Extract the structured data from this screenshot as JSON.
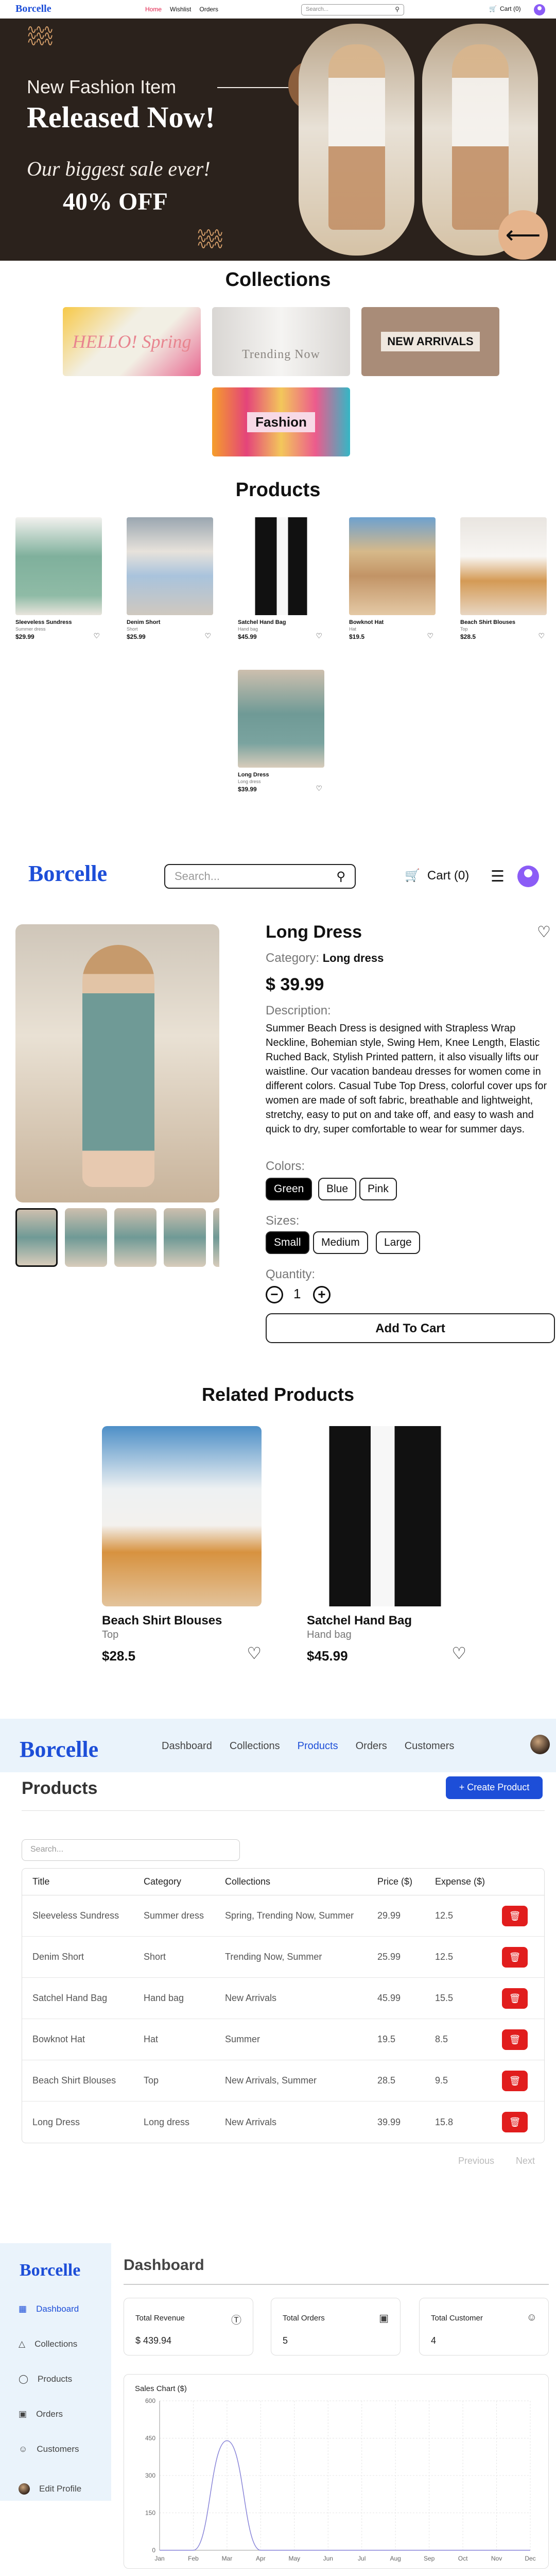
{
  "store_nav": {
    "logo": "Borcelle",
    "links": [
      {
        "label": "Home",
        "active": true
      },
      {
        "label": "Wishlist",
        "active": false
      },
      {
        "label": "Orders",
        "active": false
      }
    ],
    "search_placeholder": "Search...",
    "cart_label": "Cart (0)"
  },
  "hero": {
    "line1": "New Fashion Item",
    "line2": "Released Now!",
    "line3": "Our biggest sale ever!",
    "line4": "40% OFF"
  },
  "collections": {
    "title": "Collections",
    "cards": [
      {
        "label": "HELLO! Spring"
      },
      {
        "label": "Trending Now"
      },
      {
        "label": "NEW ARRIVALS"
      },
      {
        "label": "Fashion"
      }
    ]
  },
  "products": {
    "title": "Products",
    "items": [
      {
        "name": "Sleeveless Sundress",
        "category": "Summer dress",
        "price": "$29.99"
      },
      {
        "name": "Denim Short",
        "category": "Short",
        "price": "$25.99"
      },
      {
        "name": "Satchel Hand Bag",
        "category": "Hand bag",
        "price": "$45.99"
      },
      {
        "name": "Bowknot Hat",
        "category": "Hat",
        "price": "$19.5"
      },
      {
        "name": "Beach Shirt Blouses",
        "category": "Top",
        "price": "$28.5"
      },
      {
        "name": "Long Dress",
        "category": "Long dress",
        "price": "$39.99"
      }
    ]
  },
  "detail_nav": {
    "logo": "Borcelle",
    "search_placeholder": "Search...",
    "cart_label": "Cart (0)"
  },
  "detail": {
    "title": "Long Dress",
    "category_label": "Category:",
    "category_value": "Long dress",
    "price": "$ 39.99",
    "description_label": "Description:",
    "description": "Summer Beach Dress is designed with Strapless Wrap Neckline, Bohemian style, Swing Hem, Knee Length, Elastic Ruched Back, Stylish Printed pattern, it also visually lifts our waistline. Our vacation bandeau dresses for women come in different colors. Casual Tube Top Dress, colorful cover ups for women are made of soft fabric, breathable and lightweight, stretchy, easy to put on and take off, and easy to wash and quick to dry, super comfortable to wear for summer days.",
    "colors_label": "Colors:",
    "colors": [
      "Green",
      "Blue",
      "Pink"
    ],
    "selected_color": "Green",
    "sizes_label": "Sizes:",
    "sizes": [
      "Small",
      "Medium",
      "Large"
    ],
    "selected_size": "Small",
    "quantity_label": "Quantity:",
    "quantity": "1",
    "add_to_cart": "Add To Cart"
  },
  "related": {
    "title": "Related Products",
    "items": [
      {
        "name": "Beach Shirt Blouses",
        "category": "Top",
        "price": "$28.5"
      },
      {
        "name": "Satchel Hand Bag",
        "category": "Hand bag",
        "price": "$45.99"
      }
    ]
  },
  "admin_nav": {
    "logo": "Borcelle",
    "links": [
      {
        "label": "Dashboard",
        "active": false
      },
      {
        "label": "Collections",
        "active": false
      },
      {
        "label": "Products",
        "active": true
      },
      {
        "label": "Orders",
        "active": false
      },
      {
        "label": "Customers",
        "active": false
      }
    ]
  },
  "admin_products": {
    "title": "Products",
    "create_button": "Create Product",
    "search_placeholder": "Search...",
    "columns": [
      "Title",
      "Category",
      "Collections",
      "Price ($)",
      "Expense ($)"
    ],
    "rows": [
      [
        "Sleeveless Sundress",
        "Summer dress",
        "Spring, Trending Now, Summer",
        "29.99",
        "12.5"
      ],
      [
        "Denim Short",
        "Short",
        "Trending Now, Summer",
        "25.99",
        "12.5"
      ],
      [
        "Satchel Hand Bag",
        "Hand bag",
        "New Arrivals",
        "45.99",
        "15.5"
      ],
      [
        "Bowknot Hat",
        "Hat",
        "Summer",
        "19.5",
        "8.5"
      ],
      [
        "Beach Shirt Blouses",
        "Top",
        "New Arrivals, Summer",
        "28.5",
        "9.5"
      ],
      [
        "Long Dress",
        "Long dress",
        "New Arrivals",
        "39.99",
        "15.8"
      ]
    ],
    "prev_label": "Previous",
    "next_label": "Next"
  },
  "dashboard": {
    "logo": "Borcelle",
    "sidebar": [
      {
        "label": "Dashboard",
        "icon": "dashboard-icon",
        "active": true
      },
      {
        "label": "Collections",
        "icon": "shapes-icon",
        "active": false
      },
      {
        "label": "Products",
        "icon": "tag-icon",
        "active": false
      },
      {
        "label": "Orders",
        "icon": "calendar-icon",
        "active": false
      },
      {
        "label": "Customers",
        "icon": "users-icon",
        "active": false
      }
    ],
    "edit_profile": "Edit Profile",
    "title": "Dashboard",
    "stats": [
      {
        "label": "Total Revenue",
        "value": "$ 439.94",
        "icon": "dollar-icon"
      },
      {
        "label": "Total Orders",
        "value": "5",
        "icon": "calendar-icon"
      },
      {
        "label": "Total Customer",
        "value": "4",
        "icon": "user-icon"
      }
    ]
  },
  "chart_data": {
    "type": "line",
    "title": "Sales Chart ($)",
    "categories": [
      "Jan",
      "Feb",
      "Mar",
      "Apr",
      "May",
      "Jun",
      "Jul",
      "Aug",
      "Sep",
      "Oct",
      "Nov",
      "Dec"
    ],
    "series": [
      {
        "values": [
          0,
          0,
          440,
          0,
          0,
          0,
          0,
          0,
          0,
          0,
          0,
          0
        ]
      }
    ],
    "ylim": [
      0,
      600
    ],
    "yticks": [
      0,
      150,
      300,
      450,
      600
    ],
    "grid": true,
    "line_color": "#8884d8"
  }
}
